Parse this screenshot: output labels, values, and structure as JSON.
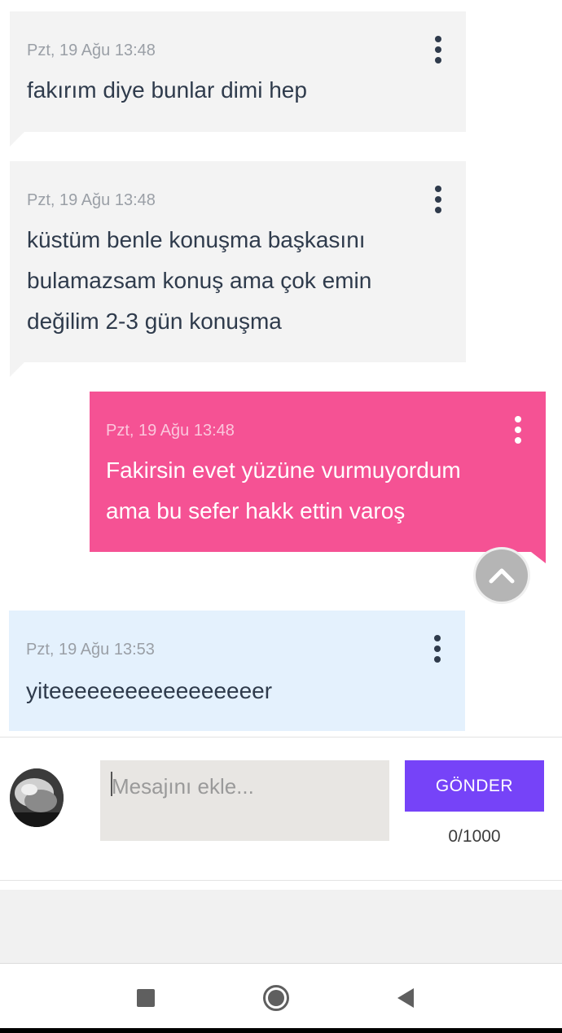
{
  "messages": [
    {
      "timestamp": "Pzt, 19 Ağu 13:48",
      "text": "fakırım diye bunlar dimi hep"
    },
    {
      "timestamp": "Pzt, 19 Ağu 13:48",
      "text": "küstüm benle konuşma başkasını\nbulamazsam konuş ama çok emin\ndeğilim 2-3 gün konuşma"
    },
    {
      "timestamp": "Pzt, 19 Ağu 13:48",
      "text": "Fakirsin evet yüzüne vurmuyordum\nama bu sefer hakk ettin varoş"
    },
    {
      "timestamp": "Pzt, 19 Ağu 13:53",
      "text": "yiteeeeeeeeeeeeeeeeer"
    }
  ],
  "composer": {
    "placeholder": "Mesajını ekle...",
    "send_label": "GÖNDER",
    "counter": "0/1000"
  },
  "colors": {
    "incoming_bg": "#f3f3f3",
    "outgoing_bg": "#f55294",
    "highlight_bg": "#e4f1fd",
    "send_button": "#7643f8"
  },
  "icons": {
    "scroll_top": "chevron-up-icon",
    "message_menu": "more-vertical-icon",
    "nav_recents": "square-icon",
    "nav_home": "circle-icon",
    "nav_back": "triangle-back-icon"
  }
}
